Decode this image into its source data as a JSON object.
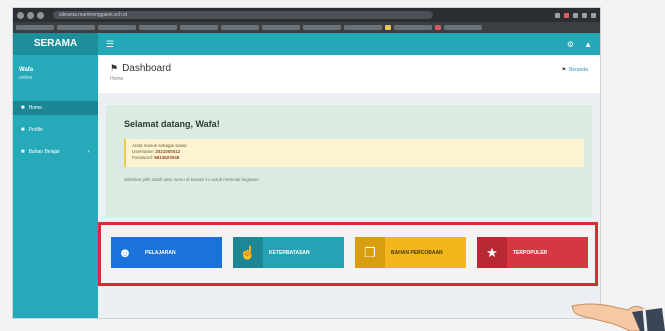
{
  "browser": {
    "url": "sibrama.mamtrenggalek.sch.id"
  },
  "app": {
    "logo": "SERAMA",
    "burger_icon": "menu-icon"
  },
  "sidebar": {
    "user_name": "Wafa",
    "user_role": "online",
    "items": [
      {
        "label": "Home",
        "icon": "home-icon",
        "active": true
      },
      {
        "label": "Profile",
        "icon": "user-icon",
        "active": false
      },
      {
        "label": "Bahan Belajar",
        "icon": "book-icon",
        "active": false
      }
    ]
  },
  "page": {
    "title": "Dashboard",
    "subtitle": "Home",
    "breadcrumb": "Beranda"
  },
  "welcome": {
    "heading": "Selamat datang, Wafa!",
    "info_line1": "Anda masuk sebagai siswa",
    "info_line2_label": "Username:",
    "info_line2_value": "2021000012",
    "info_line3_label": "Password:",
    "info_line3_value": "6813623048",
    "note": "Silahkan pilih salah satu menu di bawah ini untuk memulai kegiatan."
  },
  "tiles": [
    {
      "label": "PELAJARAN",
      "icon": "users-icon",
      "color": "#1a73d9"
    },
    {
      "label": "KETERBATASAN",
      "icon": "thumbs-up-icon",
      "color": "#25a2b3"
    },
    {
      "label": "BAHAN PERCOBAAN",
      "icon": "copy-icon",
      "color": "#f1b71c"
    },
    {
      "label": "TERPOPULER",
      "icon": "star-icon",
      "color": "#d63842"
    }
  ],
  "colors": {
    "highlight_border": "#e12638",
    "sidebar": "#26aab9"
  }
}
